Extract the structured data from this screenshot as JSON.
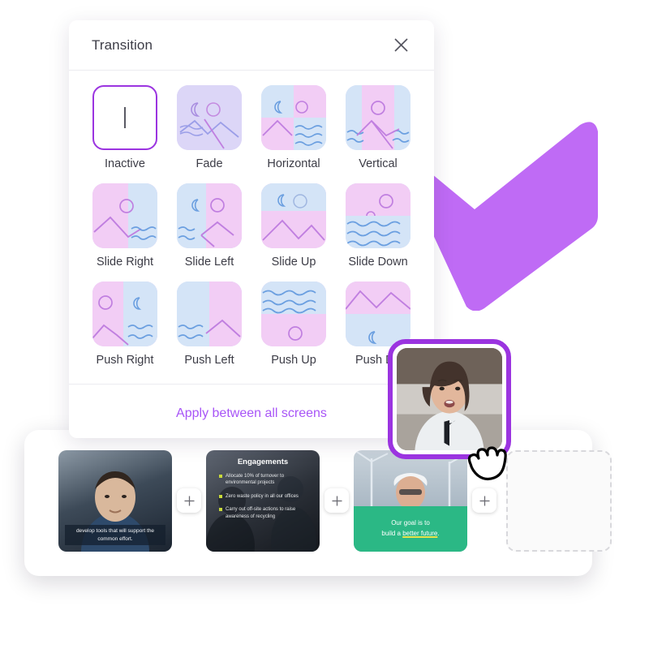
{
  "colors": {
    "accent_purple": "#9b34e0",
    "link_purple": "#a855f7",
    "checkmark": "#bf6bf5",
    "green_band": "#2bb885",
    "thumb_pink": "#f2cdf5",
    "thumb_blue": "#d4e4f7",
    "thumb_lavender": "#dcd6f7"
  },
  "panel": {
    "title": "Transition",
    "close_icon": "close-icon",
    "apply_link": "Apply between all screens",
    "transitions": [
      {
        "label": "Inactive",
        "icon": "caret-glyph",
        "selected": true
      },
      {
        "label": "Fade",
        "icon": "fade-thumb",
        "selected": false
      },
      {
        "label": "Horizontal",
        "icon": "horizontal-thumb",
        "selected": false
      },
      {
        "label": "Vertical",
        "icon": "vertical-thumb",
        "selected": false
      },
      {
        "label": "Slide Right",
        "icon": "slide-right-thumb",
        "selected": false
      },
      {
        "label": "Slide Left",
        "icon": "slide-left-thumb",
        "selected": false
      },
      {
        "label": "Slide Up",
        "icon": "slide-up-thumb",
        "selected": false
      },
      {
        "label": "Slide Down",
        "icon": "slide-down-thumb",
        "selected": false
      },
      {
        "label": "Push Right",
        "icon": "push-right-thumb",
        "selected": false
      },
      {
        "label": "Push Left",
        "icon": "push-left-thumb",
        "selected": false
      },
      {
        "label": "Push Up",
        "icon": "push-up-thumb",
        "selected": false
      },
      {
        "label": "Push Down",
        "icon": "push-down-thumb",
        "selected": false
      }
    ]
  },
  "video_overlay": {
    "name": "dragged-video-clip",
    "cursor_icon": "grabbing-hand-cursor"
  },
  "filmstrip": {
    "add_button_label": "+",
    "slides": [
      {
        "type": "video",
        "subtitle": "develop tools that will support the common effort."
      },
      {
        "type": "bullet-slide",
        "title": "Engagements",
        "bullets": [
          "Allocate 10% of turnover to environmental projects",
          "Zero waste policy in all our offices",
          "Carry out off-site actions to raise awareness of recycling"
        ]
      },
      {
        "type": "caption-slide",
        "caption_line1": "Our goal is to",
        "caption_line2_pre": "build a ",
        "caption_line2_link": "better future",
        "caption_line2_post": "."
      }
    ],
    "placeholder_label": "empty-slide-dropzone"
  }
}
